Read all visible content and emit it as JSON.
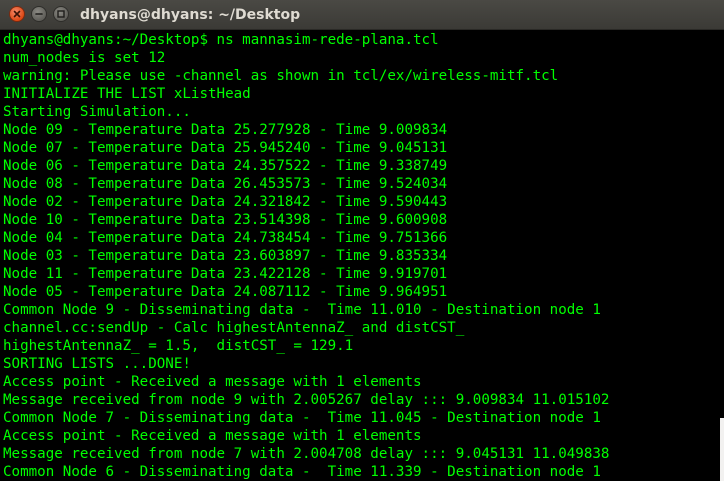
{
  "window": {
    "title": "dhyans@dhyans: ~/Desktop"
  },
  "terminal": {
    "text_color": "#00ff00",
    "background_color": "#000000",
    "lines": [
      "dhyans@dhyans:~/Desktop$ ns mannasim-rede-plana.tcl",
      "num_nodes is set 12",
      "warning: Please use -channel as shown in tcl/ex/wireless-mitf.tcl",
      "INITIALIZE THE LIST xListHead",
      "Starting Simulation...",
      "Node 09 - Temperature Data 25.277928 - Time 9.009834",
      "Node 07 - Temperature Data 25.945240 - Time 9.045131",
      "Node 06 - Temperature Data 24.357522 - Time 9.338749",
      "Node 08 - Temperature Data 26.453573 - Time 9.524034",
      "Node 02 - Temperature Data 24.321842 - Time 9.590443",
      "Node 10 - Temperature Data 23.514398 - Time 9.600908",
      "Node 04 - Temperature Data 24.738454 - Time 9.751366",
      "Node 03 - Temperature Data 23.603897 - Time 9.835334",
      "Node 11 - Temperature Data 23.422128 - Time 9.919701",
      "Node 05 - Temperature Data 24.087112 - Time 9.964951",
      "Common Node 9 - Disseminating data -  Time 11.010 - Destination node 1",
      "channel.cc:sendUp - Calc highestAntennaZ_ and distCST_",
      "highestAntennaZ_ = 1.5,  distCST_ = 129.1",
      "SORTING LISTS ...DONE!",
      "Access point - Received a message with 1 elements",
      "Message received from node 9 with 2.005267 delay ::: 9.009834 11.015102",
      "Common Node 7 - Disseminating data -  Time 11.045 - Destination node 1",
      "Access point - Received a message with 1 elements",
      "Message received from node 7 with 2.004708 delay ::: 9.045131 11.049838",
      "Common Node 6 - Disseminating data -  Time 11.339 - Destination node 1"
    ]
  }
}
